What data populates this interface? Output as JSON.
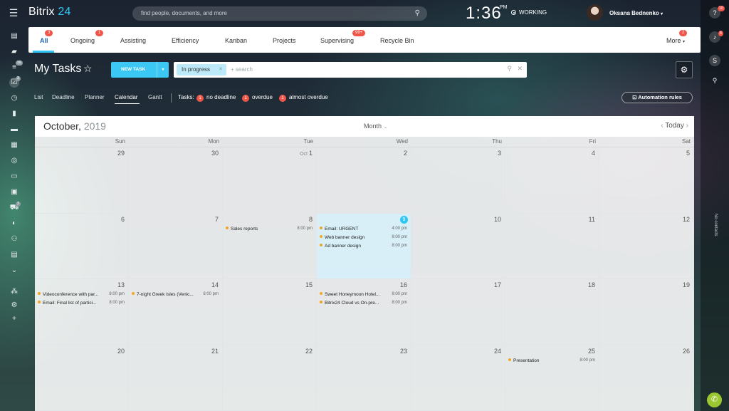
{
  "top": {
    "logo_a": "Bitrix",
    "logo_b": "24",
    "search_placeholder": "find people, documents, and more",
    "clock": "1:36",
    "ampm": "PM",
    "status": "WORKING",
    "user": "Oksana Bednenko"
  },
  "left_sidebar": {
    "badges": {
      "tasks_filter": "39",
      "tasks": "3",
      "shop": "3"
    }
  },
  "right_sidebar": {
    "help_badge": "10",
    "notify_badge": "8",
    "no_contacts": "No contacts"
  },
  "tabs": [
    {
      "label": "All",
      "badge": "3"
    },
    {
      "label": "Ongoing",
      "badge": "1"
    },
    {
      "label": "Assisting",
      "badge": ""
    },
    {
      "label": "Efficiency",
      "badge": ""
    },
    {
      "label": "Kanban",
      "badge": ""
    },
    {
      "label": "Projects",
      "badge": ""
    },
    {
      "label": "Supervising",
      "badge": "99+"
    },
    {
      "label": "Recycle Bin",
      "badge": ""
    },
    {
      "label": "More",
      "badge": "2"
    }
  ],
  "toolbar": {
    "title": "My Tasks",
    "new_task": "NEW TASK",
    "filter_chip": "In progress",
    "search_placeholder": "+ search"
  },
  "views": [
    "List",
    "Deadline",
    "Planner",
    "Calendar",
    "Gantt"
  ],
  "counters": {
    "label": "Tasks:",
    "items": [
      {
        "count": "1",
        "label": "no deadline"
      },
      {
        "count": "1",
        "label": "overdue"
      },
      {
        "count": "1",
        "label": "almost overdue"
      }
    ]
  },
  "automation": "Automation rules",
  "calendar": {
    "month": "October,",
    "year": "2019",
    "mode": "Month",
    "today_label": "Today",
    "weekdays": [
      "Sun",
      "Mon",
      "Tue",
      "Wed",
      "Thu",
      "Fri",
      "Sat"
    ],
    "weeks": [
      [
        {
          "d": "29"
        },
        {
          "d": "30"
        },
        {
          "d": "1",
          "pre": "Oct"
        },
        {
          "d": "2"
        },
        {
          "d": "3"
        },
        {
          "d": "4"
        },
        {
          "d": "5"
        }
      ],
      [
        {
          "d": "6"
        },
        {
          "d": "7"
        },
        {
          "d": "8",
          "events": [
            {
              "title": "Sales reports",
              "time": "8:00 pm"
            }
          ]
        },
        {
          "d": "9",
          "today": true,
          "events": [
            {
              "title": "Email: URGENT",
              "time": "4:00 pm"
            },
            {
              "title": "Web banner design",
              "time": "8:00 pm"
            },
            {
              "title": "Ad banner design",
              "time": "8:00 pm"
            }
          ]
        },
        {
          "d": "10"
        },
        {
          "d": "11"
        },
        {
          "d": "12"
        }
      ],
      [
        {
          "d": "13",
          "events": [
            {
              "title": "Videoconference with par...",
              "time": "8:00 pm"
            },
            {
              "title": "Email: Final list of partici...",
              "time": "8:00 pm"
            }
          ]
        },
        {
          "d": "14",
          "events": [
            {
              "title": "7-night Greek Isles (Venic...",
              "time": "8:00 pm"
            }
          ]
        },
        {
          "d": "15"
        },
        {
          "d": "16",
          "events": [
            {
              "title": "Sweet Honeymoon Hotel...",
              "time": "8:00 pm"
            },
            {
              "title": "Bitrix24 Cloud vs On-pre...",
              "time": "8:00 pm"
            }
          ]
        },
        {
          "d": "17"
        },
        {
          "d": "18"
        },
        {
          "d": "19"
        }
      ],
      [
        {
          "d": "20"
        },
        {
          "d": "21"
        },
        {
          "d": "22"
        },
        {
          "d": "23"
        },
        {
          "d": "24"
        },
        {
          "d": "25",
          "events": [
            {
              "title": "Presentation",
              "time": "8:00 pm"
            }
          ]
        },
        {
          "d": "26"
        }
      ]
    ]
  }
}
